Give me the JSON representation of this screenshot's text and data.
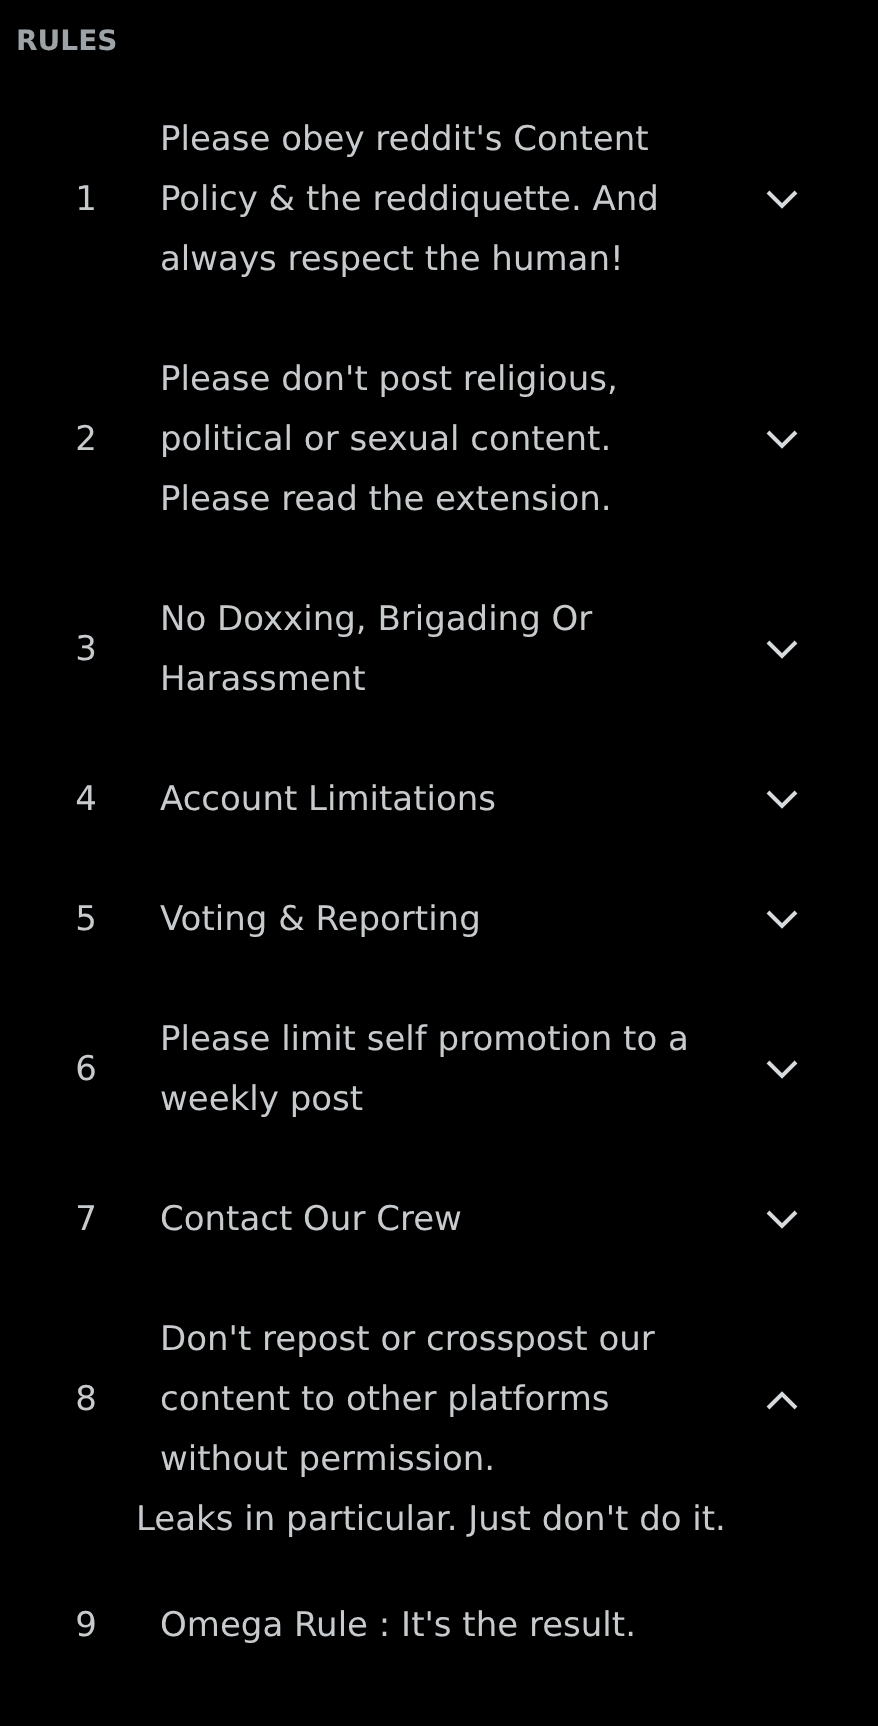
{
  "heading": "RULES",
  "rules": [
    {
      "number": "1",
      "title": "Please obey reddit's Content Policy & the reddiquette. And always respect the human!",
      "kind": "collapsible",
      "expanded": false
    },
    {
      "number": "2",
      "title": "Please don't post religious, political or sexual content. Please read the extension.",
      "kind": "collapsible",
      "expanded": false
    },
    {
      "number": "3",
      "title": "No Doxxing, Brigading Or Harassment",
      "kind": "collapsible",
      "expanded": false
    },
    {
      "number": "4",
      "title": "Account Limitations",
      "kind": "collapsible",
      "expanded": false
    },
    {
      "number": "5",
      "title": "Voting & Reporting",
      "kind": "collapsible",
      "expanded": false
    },
    {
      "number": "6",
      "title": "Please limit self promotion to a weekly post",
      "kind": "collapsible",
      "expanded": false
    },
    {
      "number": "7",
      "title": "Contact Our Crew",
      "kind": "collapsible",
      "expanded": false
    },
    {
      "number": "8",
      "title": "Don't repost or crosspost our content to other platforms without permission.",
      "kind": "collapsible",
      "expanded": true,
      "description": "Leaks in particular. Just don't do it."
    },
    {
      "number": "9",
      "title": "Omega Rule : It's the result.",
      "kind": "plain"
    }
  ]
}
